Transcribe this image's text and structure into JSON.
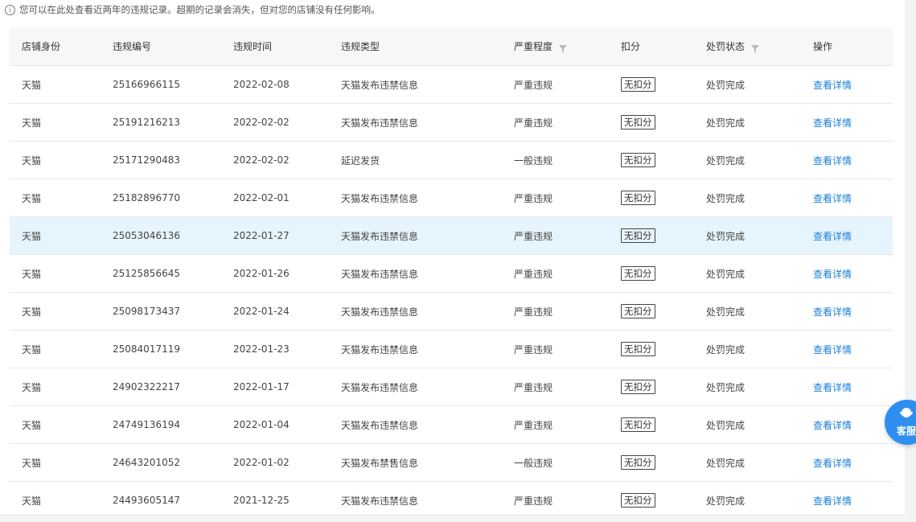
{
  "notice": "您可以在此处查看近两年的违规记录。超期的记录会消失，但对您的店铺没有任何影响。",
  "columns": [
    "店铺身份",
    "违规编号",
    "违规时间",
    "违规类型",
    "严重程度",
    "扣分",
    "处罚状态",
    "操作"
  ],
  "rows": [
    {
      "shop": "天猫",
      "id": "25166966115",
      "date": "2022-02-08",
      "type": "天猫发布违禁信息",
      "severity": "严重违规",
      "deduct": "无扣分",
      "status": "处罚完成",
      "action": "查看详情"
    },
    {
      "shop": "天猫",
      "id": "25191216213",
      "date": "2022-02-02",
      "type": "天猫发布违禁信息",
      "severity": "严重违规",
      "deduct": "无扣分",
      "status": "处罚完成",
      "action": "查看详情"
    },
    {
      "shop": "天猫",
      "id": "25171290483",
      "date": "2022-02-02",
      "type": "延迟发货",
      "severity": "一般违规",
      "deduct": "无扣分",
      "status": "处罚完成",
      "action": "查看详情"
    },
    {
      "shop": "天猫",
      "id": "25182896770",
      "date": "2022-02-01",
      "type": "天猫发布违禁信息",
      "severity": "严重违规",
      "deduct": "无扣分",
      "status": "处罚完成",
      "action": "查看详情"
    },
    {
      "shop": "天猫",
      "id": "25053046136",
      "date": "2022-01-27",
      "type": "天猫发布违禁信息",
      "severity": "严重违规",
      "deduct": "无扣分",
      "status": "处罚完成",
      "action": "查看详情"
    },
    {
      "shop": "天猫",
      "id": "25125856645",
      "date": "2022-01-26",
      "type": "天猫发布违禁信息",
      "severity": "严重违规",
      "deduct": "无扣分",
      "status": "处罚完成",
      "action": "查看详情"
    },
    {
      "shop": "天猫",
      "id": "25098173437",
      "date": "2022-01-24",
      "type": "天猫发布违禁信息",
      "severity": "严重违规",
      "deduct": "无扣分",
      "status": "处罚完成",
      "action": "查看详情"
    },
    {
      "shop": "天猫",
      "id": "25084017119",
      "date": "2022-01-23",
      "type": "天猫发布违禁信息",
      "severity": "严重违规",
      "deduct": "无扣分",
      "status": "处罚完成",
      "action": "查看详情"
    },
    {
      "shop": "天猫",
      "id": "24902322217",
      "date": "2022-01-17",
      "type": "天猫发布违禁信息",
      "severity": "严重违规",
      "deduct": "无扣分",
      "status": "处罚完成",
      "action": "查看详情"
    },
    {
      "shop": "天猫",
      "id": "24749136194",
      "date": "2022-01-04",
      "type": "天猫发布违禁信息",
      "severity": "严重违规",
      "deduct": "无扣分",
      "status": "处罚完成",
      "action": "查看详情"
    },
    {
      "shop": "天猫",
      "id": "24643201052",
      "date": "2022-01-02",
      "type": "天猫发布禁售信息",
      "severity": "一般违规",
      "deduct": "无扣分",
      "status": "处罚完成",
      "action": "查看详情"
    },
    {
      "shop": "天猫",
      "id": "24493605147",
      "date": "2021-12-25",
      "type": "天猫发布违禁信息",
      "severity": "严重违规",
      "deduct": "无扣分",
      "status": "处罚完成",
      "action": "查看详情"
    }
  ],
  "customer_service": {
    "label": "客服",
    "icon": "headset-icon"
  },
  "colors": {
    "link": "#1a7fd6",
    "highlight_row": "#e6f4fd",
    "cs_button": "#2e8ff0"
  }
}
